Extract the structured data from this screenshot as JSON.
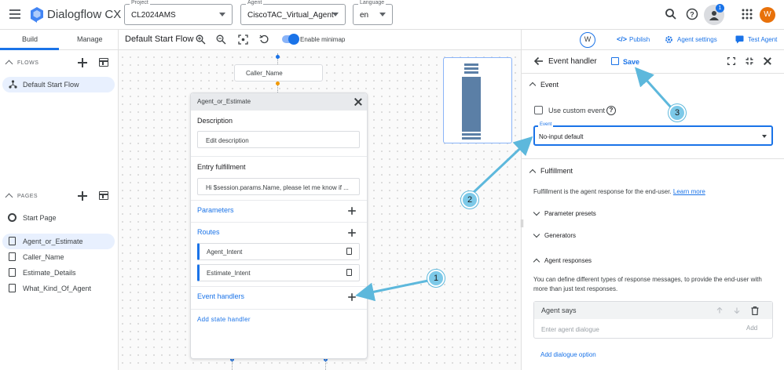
{
  "app": {
    "title": "Dialogflow CX",
    "brand_color": "#1a73e8"
  },
  "topbar": {
    "project": {
      "label": "Project",
      "value": "CL2024AMS"
    },
    "agent": {
      "label": "Agent",
      "value": "CiscoTAC_Virtual_Agent"
    },
    "language": {
      "label": "Language",
      "value": "en"
    },
    "notification_count": "1",
    "avatar_initial": "W"
  },
  "sidebar": {
    "tabs": [
      {
        "label": "Build"
      },
      {
        "label": "Manage"
      }
    ],
    "flows_section": "FLOWS",
    "flows": [
      {
        "label": "Default Start Flow"
      }
    ],
    "pages_section": "PAGES",
    "pages": [
      {
        "label": "Start Page"
      },
      {
        "label": "Agent_or_Estimate"
      },
      {
        "label": "Caller_Name"
      },
      {
        "label": "Estimate_Details"
      },
      {
        "label": "What_Kind_Of_Agent"
      }
    ]
  },
  "canvas": {
    "flow_title": "Default Start Flow",
    "minimap_label": "Enable minimap",
    "node_caller": "Caller_Name",
    "user_chip": "W",
    "publish_label": "Publish",
    "agent_settings_label": "Agent settings",
    "test_agent_label": "Test Agent"
  },
  "page_card": {
    "title": "Agent_or_Estimate",
    "description_label": "Description",
    "description_value": "Edit description",
    "entry_label": "Entry fulfillment",
    "entry_value": "Hi $session.params.Name, please let me know if ...",
    "parameters_label": "Parameters",
    "routes_label": "Routes",
    "routes": [
      {
        "label": "Agent_Intent"
      },
      {
        "label": "Estimate_Intent"
      }
    ],
    "event_handlers_label": "Event handlers",
    "add_state_handler_label": "Add state handler"
  },
  "annotations": [
    {
      "num": "1"
    },
    {
      "num": "2"
    },
    {
      "num": "3"
    }
  ],
  "event_panel": {
    "title": "Event handler",
    "save_label": "Save",
    "event_section": "Event",
    "use_custom_event": "Use custom event",
    "event_field_label": "Event",
    "event_value": "No-input default",
    "fulfillment_section": "Fulfillment",
    "fulfillment_desc": "Fulfillment is the agent response for the end-user.",
    "learn_more": "Learn more",
    "parameter_presets": "Parameter presets",
    "generators": "Generators",
    "agent_responses": "Agent responses",
    "responses_desc": "You can define different types of response messages, to provide the end-user with more than just text responses.",
    "agent_says": "Agent says",
    "dialogue_placeholder": "Enter agent dialogue",
    "add_label": "Add",
    "add_dialogue_option": "Add dialogue option"
  }
}
